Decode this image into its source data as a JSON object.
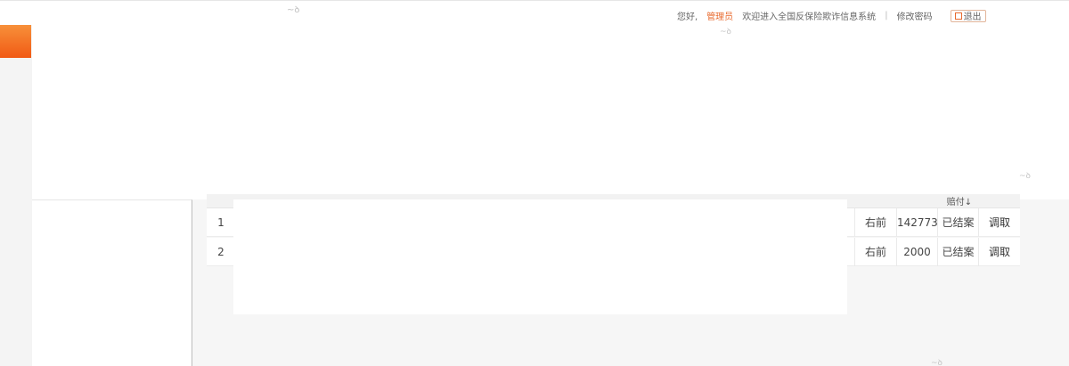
{
  "topbar": {
    "watermark_left": "~ꝺ",
    "greeting": "您好,",
    "user": "管理员",
    "welcome": "欢迎进入全国反保险欺诈信息系统",
    "divider": "|",
    "change_password": "修改密码",
    "logout_label": "退出"
  },
  "watermarks": [
    "~ꝺ",
    "~ꝺ",
    "~ꝺ"
  ],
  "table": {
    "visible_header": "赔付↓",
    "rows": [
      {
        "index": "1",
        "position": "右前",
        "amount": "142773",
        "status": "已结案",
        "action": "调取"
      },
      {
        "index": "2",
        "position": "右前",
        "amount": "2000",
        "status": "已结案",
        "action": "调取"
      }
    ]
  },
  "colors": {
    "accent": "#f15a14",
    "accent_light": "#f7903a",
    "background": "#f6f6f6"
  },
  "icons": {
    "menu": "menu-icon",
    "logout": "logout-icon"
  }
}
